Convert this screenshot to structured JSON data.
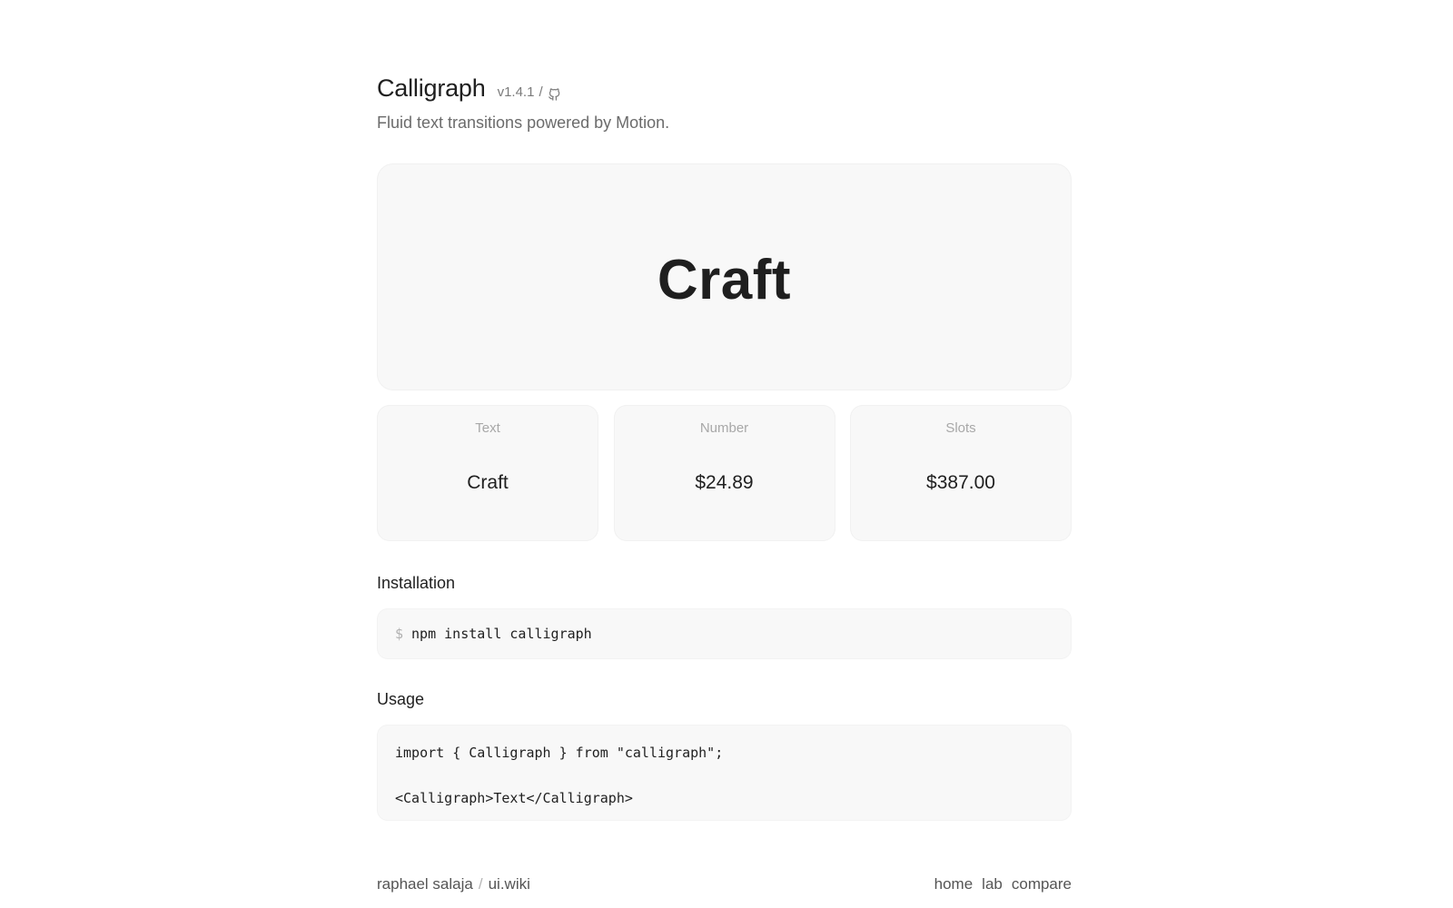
{
  "header": {
    "title": "Calligraph",
    "version": "v1.4.1",
    "separator": "/",
    "github_icon": "github-icon"
  },
  "subtitle": "Fluid text transitions powered by Motion.",
  "hero": {
    "text": "Craft"
  },
  "cards": [
    {
      "label": "Text",
      "value": "Craft"
    },
    {
      "label": "Number",
      "value": "$24.89"
    },
    {
      "label": "Slots",
      "value": "$387.00"
    }
  ],
  "installation": {
    "title": "Installation",
    "prompt": "$",
    "command": "npm install calligraph"
  },
  "usage": {
    "title": "Usage",
    "lines": [
      "import { Calligraph } from \"calligraph\";",
      "<Calligraph>Text</Calligraph>"
    ]
  },
  "footer": {
    "author": "raphael salaja",
    "separator": "/",
    "site": "ui.wiki",
    "nav": [
      "home",
      "lab",
      "compare"
    ]
  },
  "colors": {
    "panel_bg": "#f8f8f8",
    "text_primary": "#1f1f1f",
    "text_muted": "#a8a8a8"
  }
}
